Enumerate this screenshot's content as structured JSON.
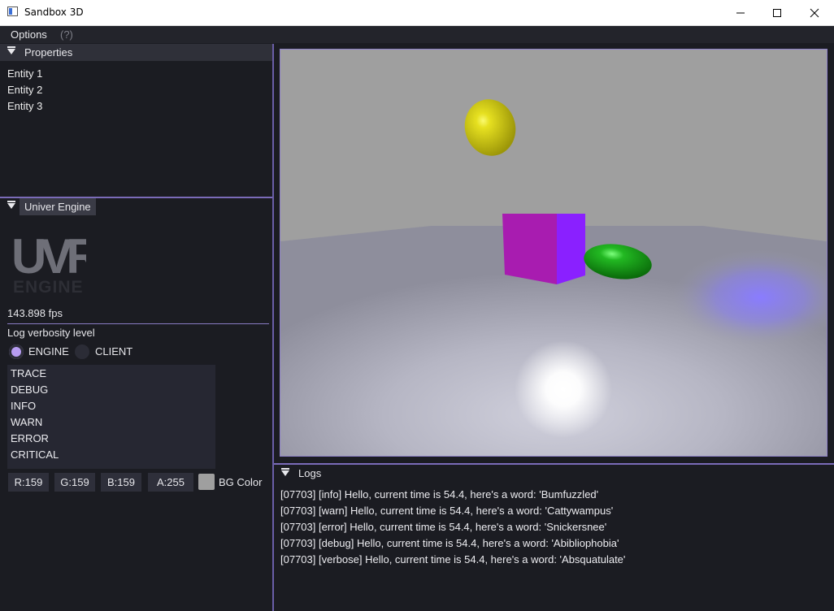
{
  "window": {
    "title": "Sandbox 3D",
    "icons": [
      "app-icon",
      "minimize-icon",
      "maximize-icon",
      "close-icon"
    ]
  },
  "menu": {
    "options_label": "Options",
    "help_label": "(?)"
  },
  "properties": {
    "header": "Properties",
    "entities": [
      "Entity 1",
      "Entity 2",
      "Entity 3"
    ]
  },
  "engine": {
    "header": "Univer Engine",
    "logo_text": [
      "UVR",
      "ENGINE"
    ],
    "fps": "143.898 fps",
    "verbosity_label": "Log verbosity level",
    "radios": [
      {
        "label": "ENGINE",
        "checked": true
      },
      {
        "label": "CLIENT",
        "checked": false
      }
    ],
    "levels": [
      "TRACE",
      "DEBUG",
      "INFO",
      "WARN",
      "ERROR",
      "CRITICAL"
    ],
    "bg_color": {
      "r": "R:159",
      "g": "G:159",
      "b": "B:159",
      "a": "A:255",
      "label": "BG Color",
      "swatch": "#9f9f9f"
    }
  },
  "logs": {
    "header": "Logs",
    "lines": [
      "[07703] [info] Hello, current time is 54.4, here's a word: 'Bumfuzzled'",
      "[07703] [warn] Hello, current time is 54.4, here's a word: 'Cattywampus'",
      "[07703] [error] Hello, current time is 54.4, here's a word: 'Snickersnee'",
      "[07703] [debug] Hello, current time is 54.4, here's a word: 'Abibliophobia'",
      "[07703] [verbose] Hello, current time is 54.4, here's a word: 'Absquatulate'"
    ]
  },
  "colors": {
    "accent": "#7a6bb8",
    "panel_bg": "#1b1c22",
    "header_bg": "#2f3039",
    "viewport_border": "#8d80c8"
  }
}
